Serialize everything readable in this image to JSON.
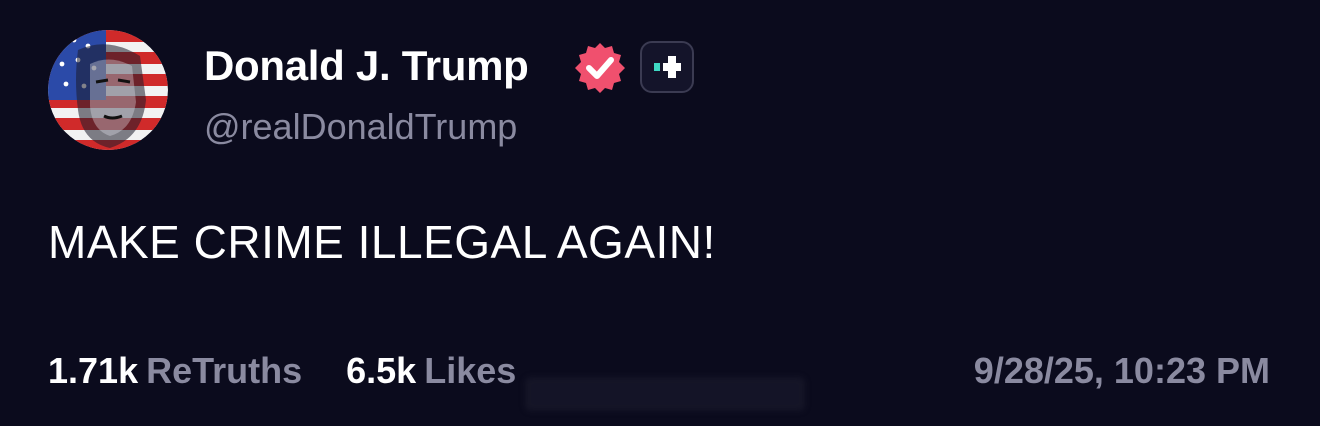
{
  "post": {
    "author": {
      "display_name": "Donald J. Trump",
      "handle": "@realDonaldTrump",
      "avatar_icon": "flag-portrait-avatar",
      "verified_icon": "verified-check-icon",
      "plus_icon": "truth-plus-icon"
    },
    "text": "MAKE CRIME ILLEGAL AGAIN!",
    "stats": {
      "retruths_count": "1.71k",
      "retruths_label": "ReTruths",
      "likes_count": "6.5k",
      "likes_label": "Likes"
    },
    "timestamp": "9/28/25, 10:23 PM"
  },
  "colors": {
    "background": "#0b0b1d",
    "muted_text": "#8a8aa0",
    "verified_badge": "#f0506e",
    "plus_accent": "#3fd9c4"
  }
}
